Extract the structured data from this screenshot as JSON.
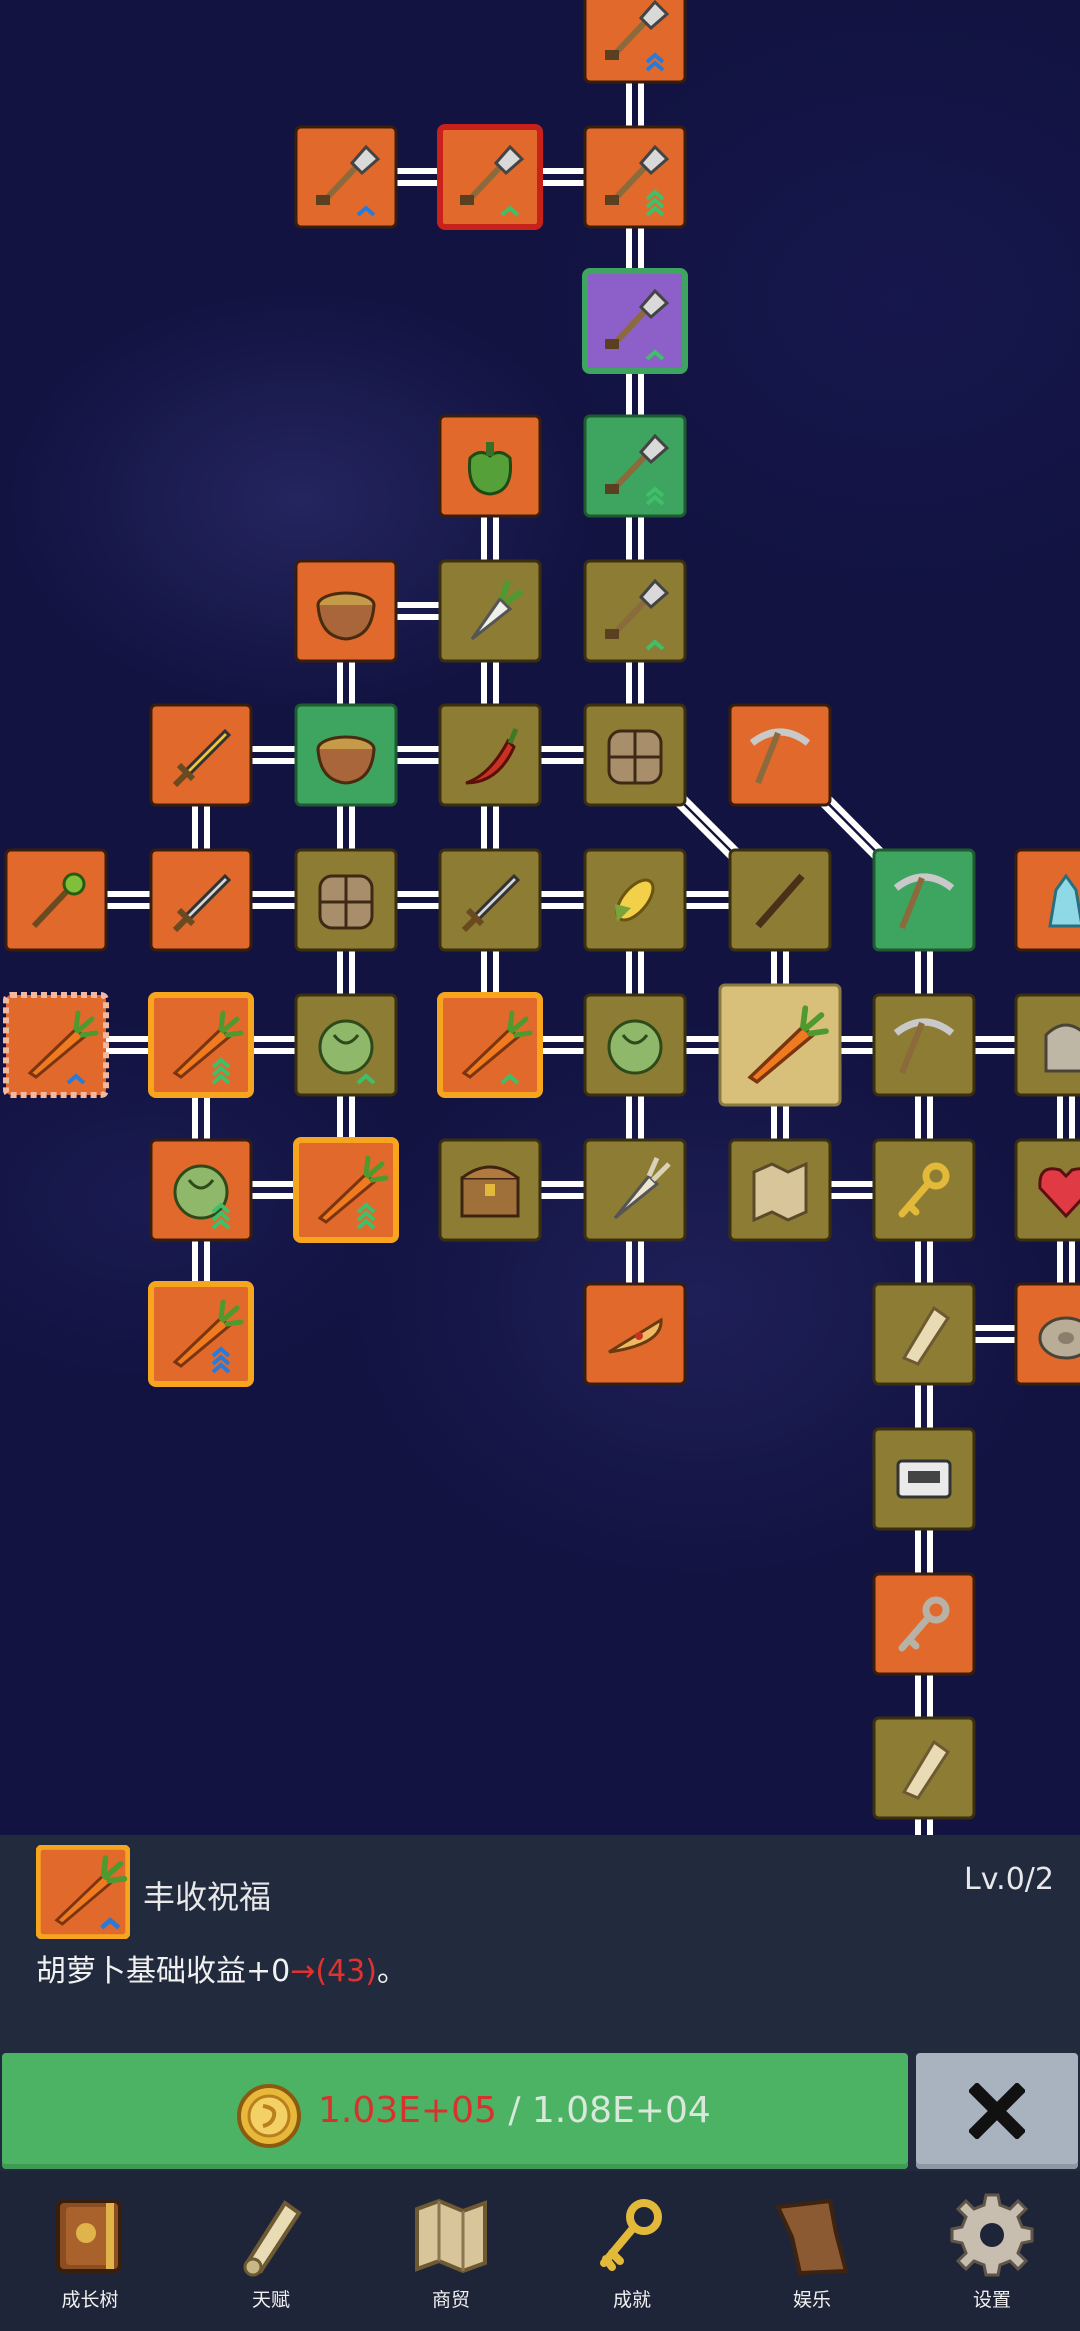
{
  "detail": {
    "name": "丰收祝福",
    "level": "Lv.0/2",
    "desc_prefix": "胡萝卜基础收益+0",
    "desc_arrow": "→",
    "desc_new": "(43)",
    "desc_suffix": "。",
    "icon": "carrot-upgrade-icon"
  },
  "purchase": {
    "coins_have": "1.03E+05",
    "separator": " / ",
    "cost": "1.08E+04",
    "icon": "gold-coin-icon"
  },
  "close": {
    "icon": "close-x-icon"
  },
  "nav": [
    {
      "label": "成长树",
      "icon": "book-icon"
    },
    {
      "label": "天赋",
      "icon": "scroll-icon"
    },
    {
      "label": "商贸",
      "icon": "map-icon"
    },
    {
      "label": "成就",
      "icon": "key-icon"
    },
    {
      "label": "娱乐",
      "icon": "cloth-icon"
    },
    {
      "label": "设置",
      "icon": "gear-icon"
    }
  ],
  "colors": {
    "orange": "#e2692c",
    "brown": "#8d7c34",
    "green": "#3ea560",
    "purple": "#8d5fc9",
    "selected": "#d9c07a",
    "buy_green": "#4cb365",
    "close_gray": "#a9b3bf"
  },
  "nodes": [
    {
      "id": "shovel-top",
      "icon": "shovel",
      "style": "orange",
      "badge": "double-blue"
    },
    {
      "id": "shovel-a",
      "icon": "shovel",
      "style": "orange",
      "badge": "single-blue"
    },
    {
      "id": "shovel-red",
      "icon": "shovel",
      "style": "orange-red",
      "badge": "single-green"
    },
    {
      "id": "shovel-b",
      "icon": "shovel",
      "style": "orange",
      "badge": "triple-green"
    },
    {
      "id": "shovel-purple",
      "icon": "shovel",
      "style": "purple",
      "badge": "single-green"
    },
    {
      "id": "pepper",
      "icon": "bell-pepper",
      "style": "orange"
    },
    {
      "id": "shovel-green",
      "icon": "shovel",
      "style": "green",
      "badge": "double-green"
    },
    {
      "id": "bowl-1",
      "icon": "bowl",
      "style": "orange"
    },
    {
      "id": "radish",
      "icon": "radish",
      "style": "brown"
    },
    {
      "id": "shovel-c",
      "icon": "shovel",
      "style": "brown",
      "badge": "single-green"
    },
    {
      "id": "golden-sword",
      "icon": "sword-gold",
      "style": "orange"
    },
    {
      "id": "bowl-2",
      "icon": "bowl",
      "style": "green"
    },
    {
      "id": "chili",
      "icon": "chili",
      "style": "brown"
    },
    {
      "id": "backpack-1",
      "icon": "backpack",
      "style": "brown"
    },
    {
      "id": "pickaxe-1",
      "icon": "pickaxe",
      "style": "orange"
    },
    {
      "id": "staff",
      "icon": "staff",
      "style": "orange"
    },
    {
      "id": "sword-1",
      "icon": "sword",
      "style": "orange"
    },
    {
      "id": "backpack-2",
      "icon": "backpack",
      "style": "brown"
    },
    {
      "id": "sword-2",
      "icon": "sword",
      "style": "brown"
    },
    {
      "id": "corn",
      "icon": "corn",
      "style": "brown"
    },
    {
      "id": "stick",
      "icon": "stick",
      "style": "brown"
    },
    {
      "id": "pickaxe-2",
      "icon": "pickaxe",
      "style": "green"
    },
    {
      "id": "crystal",
      "icon": "crystal",
      "style": "orange"
    },
    {
      "id": "carrot-blessing",
      "icon": "carrot",
      "style": "orange-dashed",
      "badge": "single-blue"
    },
    {
      "id": "carrot-2",
      "icon": "carrot",
      "style": "orange-gold",
      "badge": "triple-green"
    },
    {
      "id": "cabbage-1",
      "icon": "cabbage",
      "style": "brown",
      "badge": "single-green"
    },
    {
      "id": "carrot-3",
      "icon": "carrot",
      "style": "orange-gold",
      "badge": "single-green"
    },
    {
      "id": "cabbage-2",
      "icon": "cabbage",
      "style": "brown"
    },
    {
      "id": "carrot-center",
      "icon": "carrot",
      "style": "selected"
    },
    {
      "id": "pickaxe-3",
      "icon": "pickaxe",
      "style": "brown"
    },
    {
      "id": "stone",
      "icon": "stone",
      "style": "brown"
    },
    {
      "id": "cabbage-3",
      "icon": "cabbage",
      "style": "orange",
      "badge": "triple-green"
    },
    {
      "id": "carrot-4",
      "icon": "carrot",
      "style": "orange-gold",
      "badge": "triple-green"
    },
    {
      "id": "chest",
      "icon": "chest",
      "style": "brown"
    },
    {
      "id": "leek",
      "icon": "leek",
      "style": "brown"
    },
    {
      "id": "map",
      "icon": "map",
      "style": "brown"
    },
    {
      "id": "key-gold",
      "icon": "key-gold",
      "style": "brown"
    },
    {
      "id": "heart",
      "icon": "heart",
      "style": "brown"
    },
    {
      "id": "carrot-5",
      "icon": "carrot",
      "style": "orange-gold",
      "badge": "triple-blue"
    },
    {
      "id": "pizza",
      "icon": "pizza",
      "style": "orange"
    },
    {
      "id": "scroll",
      "icon": "scroll",
      "style": "brown"
    },
    {
      "id": "disc",
      "icon": "disc",
      "style": "orange"
    },
    {
      "id": "cassette",
      "icon": "cassette",
      "style": "brown"
    },
    {
      "id": "key-iron",
      "icon": "key-iron",
      "style": "orange"
    },
    {
      "id": "parchment",
      "icon": "parchment",
      "style": "brown"
    },
    {
      "id": "locked-rock",
      "icon": "rock",
      "style": "locked"
    }
  ]
}
